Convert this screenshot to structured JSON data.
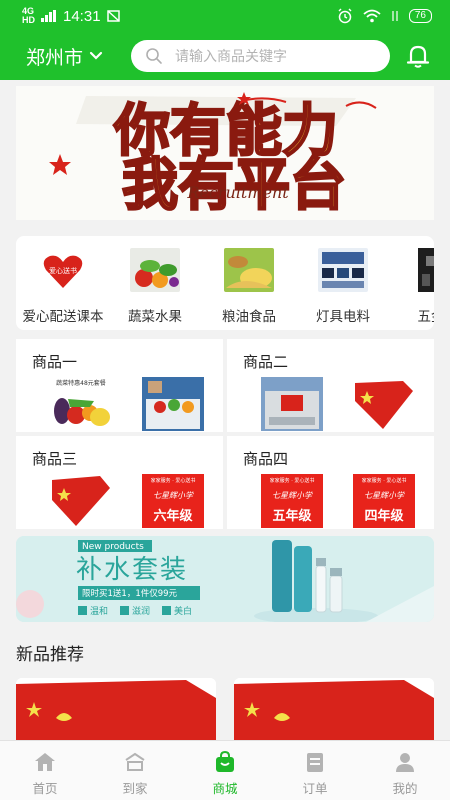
{
  "status_bar": {
    "network": "4G",
    "network_sub": "HD",
    "time": "14:31",
    "battery": "76"
  },
  "header": {
    "city": "郑州市",
    "search_placeholder": "请输入商品关键字"
  },
  "banner": {
    "line1": "你有能力",
    "line2": "我有平台",
    "subtitle": "Recruitment"
  },
  "categories": [
    {
      "label": "爱心配送课本",
      "icon": "love-delivery-thumb",
      "thumb_text": "爱心送书"
    },
    {
      "label": "蔬菜水果",
      "icon": "vegetables-thumb"
    },
    {
      "label": "粮油食品",
      "icon": "grain-oil-thumb"
    },
    {
      "label": "灯具电料",
      "icon": "lighting-thumb"
    },
    {
      "label": "五金",
      "icon": "hardware-thumb"
    }
  ],
  "products": [
    {
      "title": "商品一",
      "img1_text": "蔬菜特惠48元套餐"
    },
    {
      "title": "商品二"
    },
    {
      "title": "商品三"
    },
    {
      "title": "商品四"
    }
  ],
  "book_labels": {
    "header": "家家服务 · 爱心送书",
    "brand": "七星辉小学",
    "grade6": "六年级",
    "grade5": "五年级",
    "grade4": "四年级"
  },
  "promo": {
    "tag": "New products",
    "title": "补水套装",
    "offer": "限时买1送1，1件仅99元",
    "features": [
      "温和",
      "滋润",
      "美白"
    ]
  },
  "new_section": {
    "title": "新品推荐"
  },
  "bottom_nav": [
    {
      "label": "首页",
      "icon": "home-icon",
      "active": false
    },
    {
      "label": "到家",
      "icon": "house-delivery-icon",
      "active": false
    },
    {
      "label": "商城",
      "icon": "shopping-bag-icon",
      "active": true
    },
    {
      "label": "订单",
      "icon": "order-icon",
      "active": false
    },
    {
      "label": "我的",
      "icon": "profile-icon",
      "active": false
    }
  ],
  "colors": {
    "brand_green": "#1fc12c",
    "active_nav": "#1fb82a",
    "banner_red": "#d8231b",
    "banner_gold": "#f2c230",
    "promo_teal": "#2aa59b"
  }
}
